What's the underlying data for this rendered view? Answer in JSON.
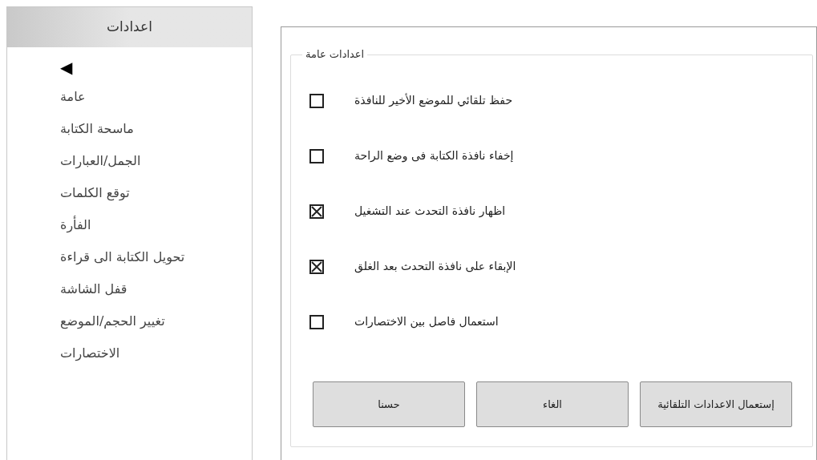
{
  "sidebar": {
    "title": "اعدادات",
    "back_arrow": "◀",
    "items": [
      {
        "label": "عامة"
      },
      {
        "label": "ماسحة الكتابة"
      },
      {
        "label": "الجمل/العبارات"
      },
      {
        "label": "توقع الكلمات"
      },
      {
        "label": "الفأرة"
      },
      {
        "label": "تحويل الكتابة الى قراءة"
      },
      {
        "label": "قفل الشاشة"
      },
      {
        "label": "تغيير الحجم/الموضع"
      },
      {
        "label": "الاختصارات"
      }
    ]
  },
  "group": {
    "title": "اعدادات عامة",
    "options": [
      {
        "label": "حفظ تلقائي للموضع الأخير للنافذة",
        "checked": false
      },
      {
        "label": "إخفاء نافذة الكتابة فى وضع الراحة",
        "checked": false
      },
      {
        "label": "اظهار نافذة التحدث عند التشغيل",
        "checked": true
      },
      {
        "label": "الإبقاء على نافذة التحدث بعد الغلق",
        "checked": true
      },
      {
        "label": "استعمال فاصل بين الاختصارات",
        "checked": false
      }
    ]
  },
  "buttons": [
    "إستعمال الاعدادات التلقائية",
    "الغاء",
    "حسنا"
  ]
}
